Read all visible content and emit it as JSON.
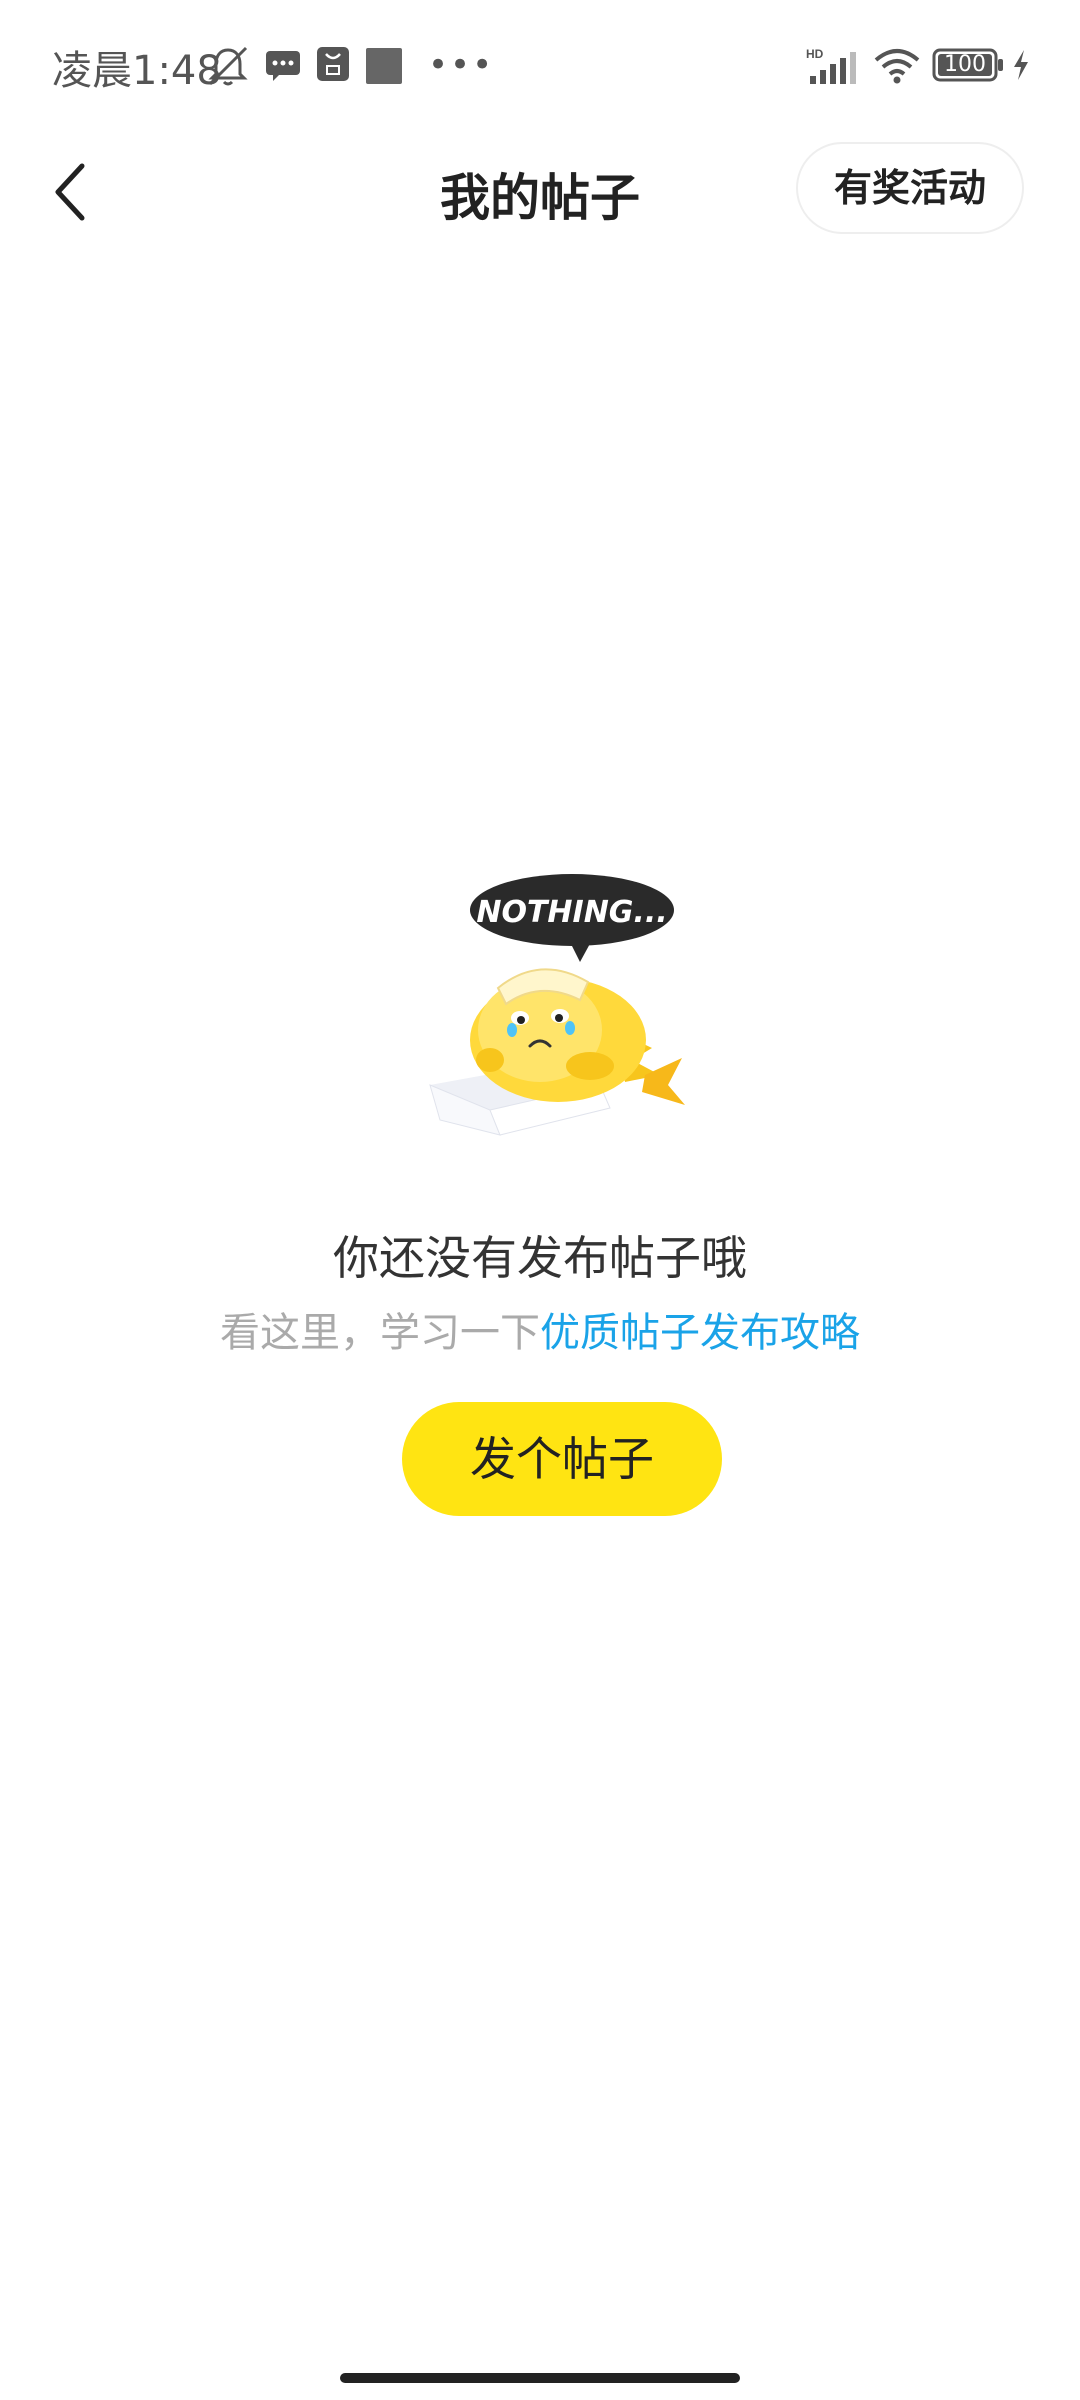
{
  "status_bar": {
    "time": "凌晨1:48",
    "battery": "100",
    "icons": [
      "bell-off-icon",
      "message-icon",
      "app-notification-icon",
      "square-icon",
      "more-dots-icon",
      "hd-signal-icon",
      "wifi-icon",
      "battery-icon",
      "charging-icon"
    ]
  },
  "header": {
    "title": "我的帖子",
    "activity_label": "有奖活动",
    "back_icon": "chevron-left-icon"
  },
  "empty_state": {
    "illustration_text": "NOTHING...",
    "title": "你还没有发布帖子哦",
    "subtitle_prefix": "看这里，学习一下",
    "guide_link": "优质帖子发布攻略",
    "post_button": "发个帖子"
  },
  "colors": {
    "accent_yellow": "#ffe412",
    "link_blue": "#1aa3e8",
    "text_gray": "#aaaaaa"
  }
}
